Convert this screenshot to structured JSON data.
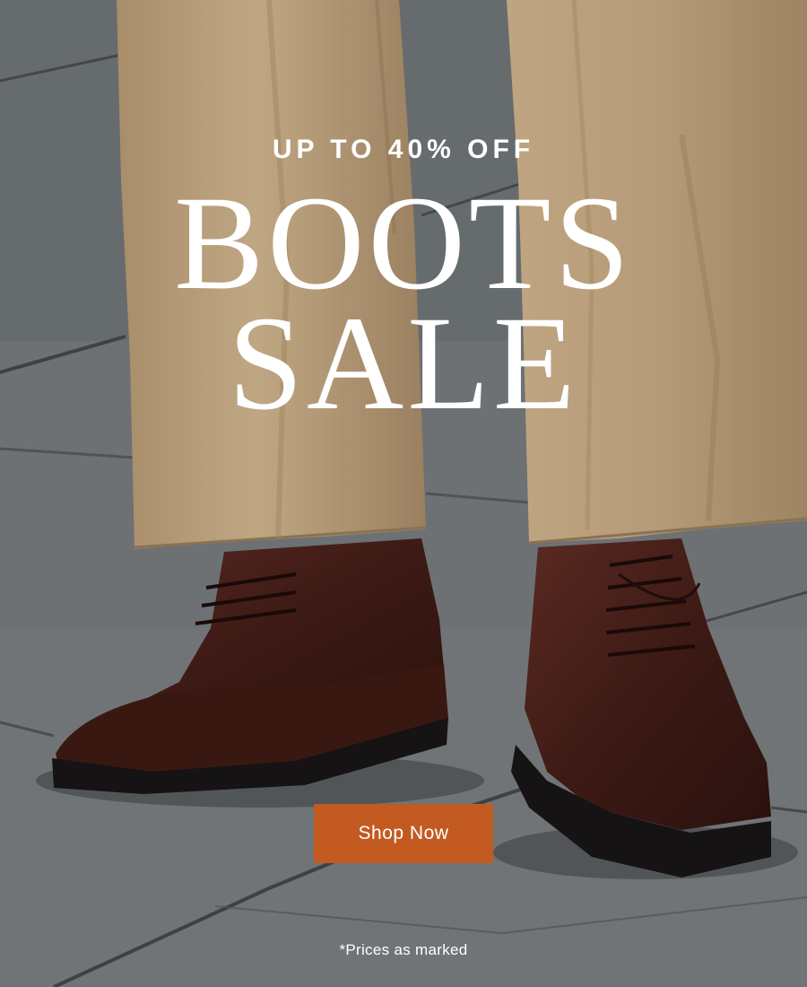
{
  "promo": {
    "eyebrow": "UP TO 40% OFF",
    "headline_line1": "BOOTS",
    "headline_line2": "SALE",
    "cta_label": "Shop Now",
    "fineprint": "*Prices as marked"
  },
  "colors": {
    "cta_background": "#c25a22",
    "text": "#ffffff",
    "trousers": "#b39a76",
    "boots": "#3a1c16",
    "pavement": "#6f7376"
  }
}
